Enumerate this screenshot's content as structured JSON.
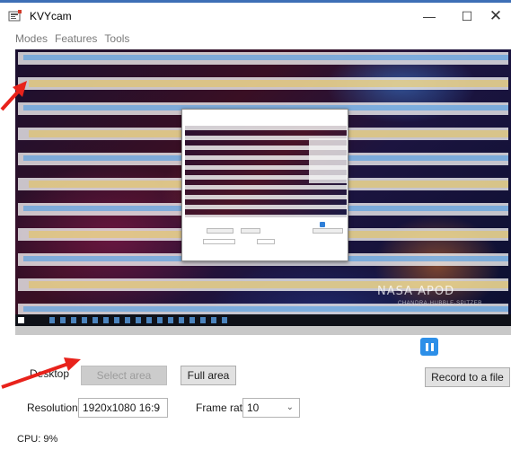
{
  "window": {
    "title": "KVYcam",
    "minimize_glyph": "—",
    "maximize_glyph": "☐",
    "close_glyph": "✕"
  },
  "menu": {
    "items": [
      {
        "label": "Modes"
      },
      {
        "label": "Features"
      },
      {
        "label": "Tools"
      }
    ]
  },
  "preview": {
    "wallpaper_brand": "NASA APOD",
    "wallpaper_credit": "CHANDRA·HUBBLE·SPITZER"
  },
  "controls": {
    "desktop_label": "Desktop",
    "select_area_label": "Select area",
    "full_area_label": "Full area",
    "record_label": "Record to a file",
    "resolutions_label": "Resolutions:",
    "resolution_value": "1920x1080  16:9",
    "frame_rate_label": "Frame rate:",
    "frame_rate_value": "10",
    "cpu_text": "CPU: 9%"
  },
  "annotations": {
    "arrow_color": "#e8221b"
  },
  "colors": {
    "accent": "#2d8fe8"
  }
}
